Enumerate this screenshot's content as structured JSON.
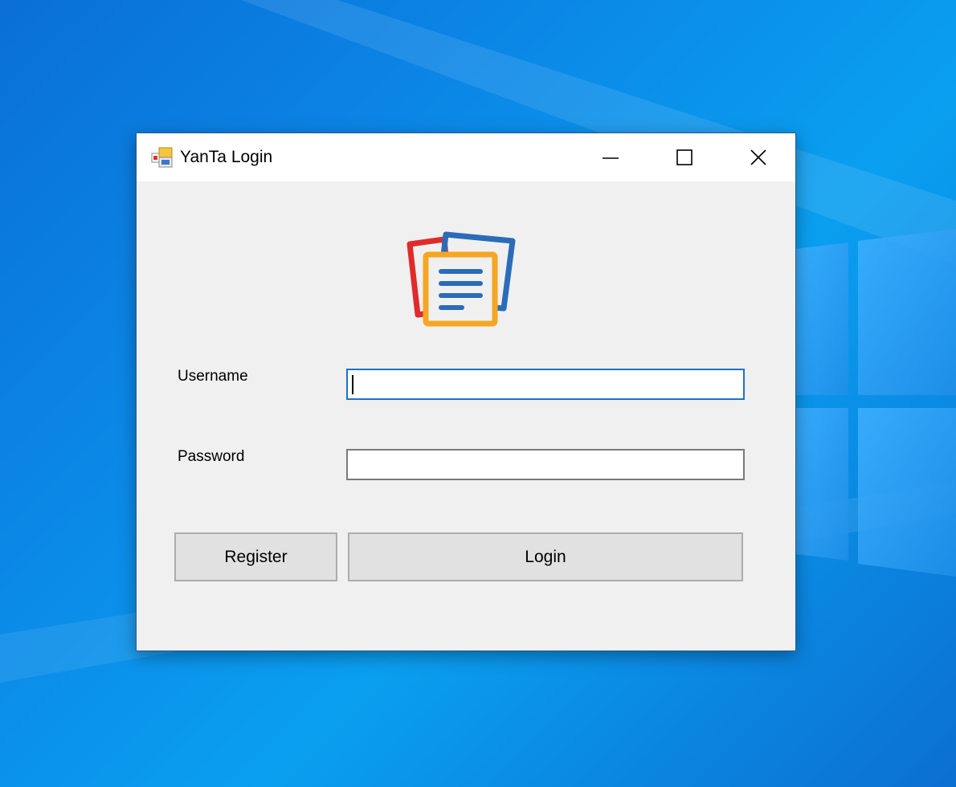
{
  "window": {
    "title": "YanTa Login",
    "controls": {
      "minimize": "minimize-icon",
      "maximize": "maximize-icon",
      "close": "close-icon"
    }
  },
  "form": {
    "username_label": "Username",
    "username_value": "",
    "password_label": "Password",
    "password_value": ""
  },
  "buttons": {
    "register_label": "Register",
    "login_label": "Login"
  },
  "colors": {
    "focus_border": "#1e72c8",
    "logo_red": "#e02b2b",
    "logo_blue": "#2b6cb8",
    "logo_orange": "#f5a623",
    "desktop_blue": "#0b86e6"
  }
}
